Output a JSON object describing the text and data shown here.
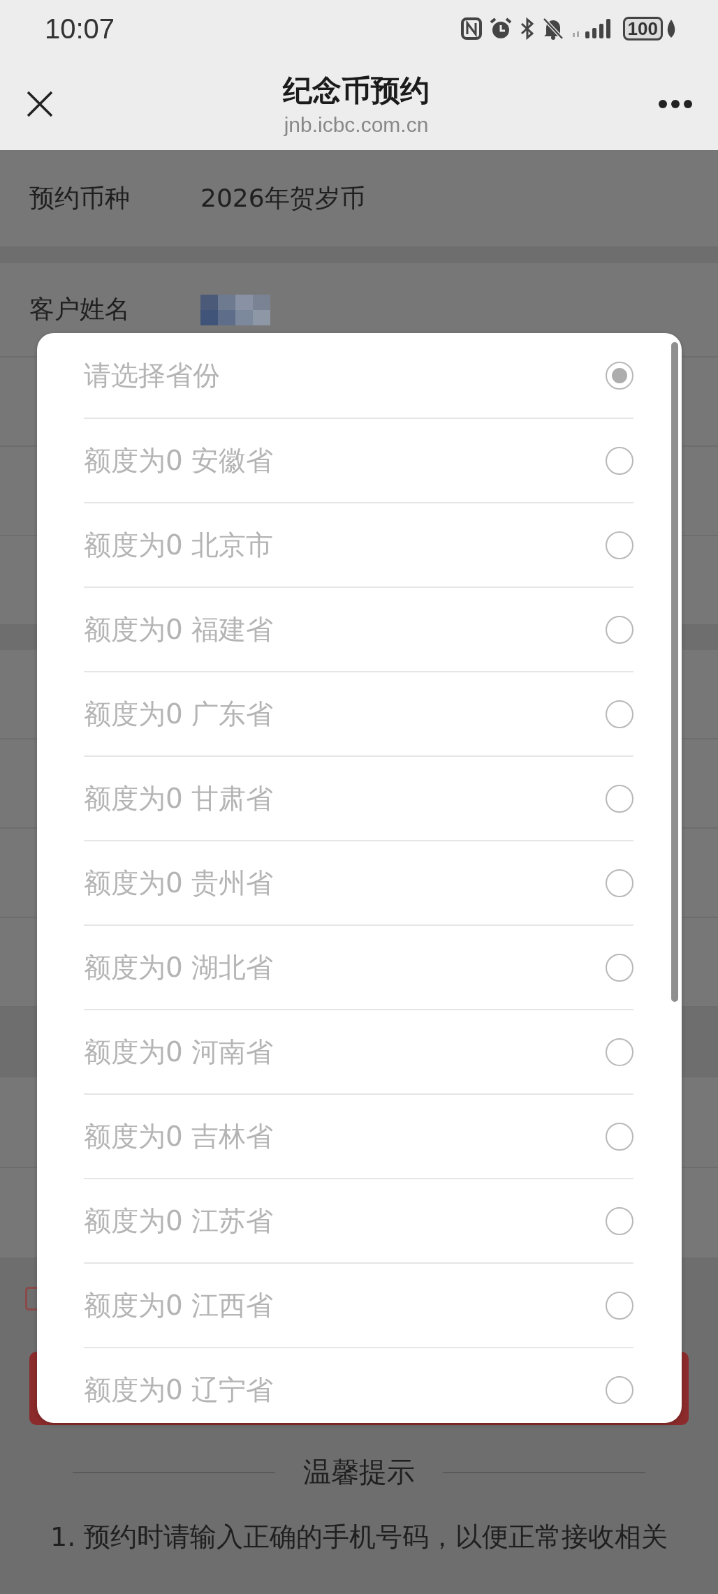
{
  "status_bar": {
    "time": "10:07",
    "battery": "100"
  },
  "nav": {
    "title": "纪念币预约",
    "url": "jnb.icbc.com.cn"
  },
  "form": {
    "rows": [
      {
        "label": "预约币种",
        "value": "2026年贺岁币"
      },
      {
        "label": "客户姓名"
      }
    ]
  },
  "picker": {
    "options": [
      {
        "label": "请选择省份",
        "selected": true
      },
      {
        "label": "额度为0 安徽省",
        "selected": false
      },
      {
        "label": "额度为0 北京市",
        "selected": false
      },
      {
        "label": "额度为0 福建省",
        "selected": false
      },
      {
        "label": "额度为0 广东省",
        "selected": false
      },
      {
        "label": "额度为0 甘肃省",
        "selected": false
      },
      {
        "label": "额度为0 贵州省",
        "selected": false
      },
      {
        "label": "额度为0 湖北省",
        "selected": false
      },
      {
        "label": "额度为0 河南省",
        "selected": false
      },
      {
        "label": "额度为0 吉林省",
        "selected": false
      },
      {
        "label": "额度为0 江苏省",
        "selected": false
      },
      {
        "label": "额度为0 江西省",
        "selected": false
      },
      {
        "label": "额度为0 辽宁省",
        "selected": false
      }
    ]
  },
  "tips": {
    "title": "温馨提示",
    "items": [
      "1. 预约时请输入正确的手机号码，以便正常接收相关"
    ]
  }
}
